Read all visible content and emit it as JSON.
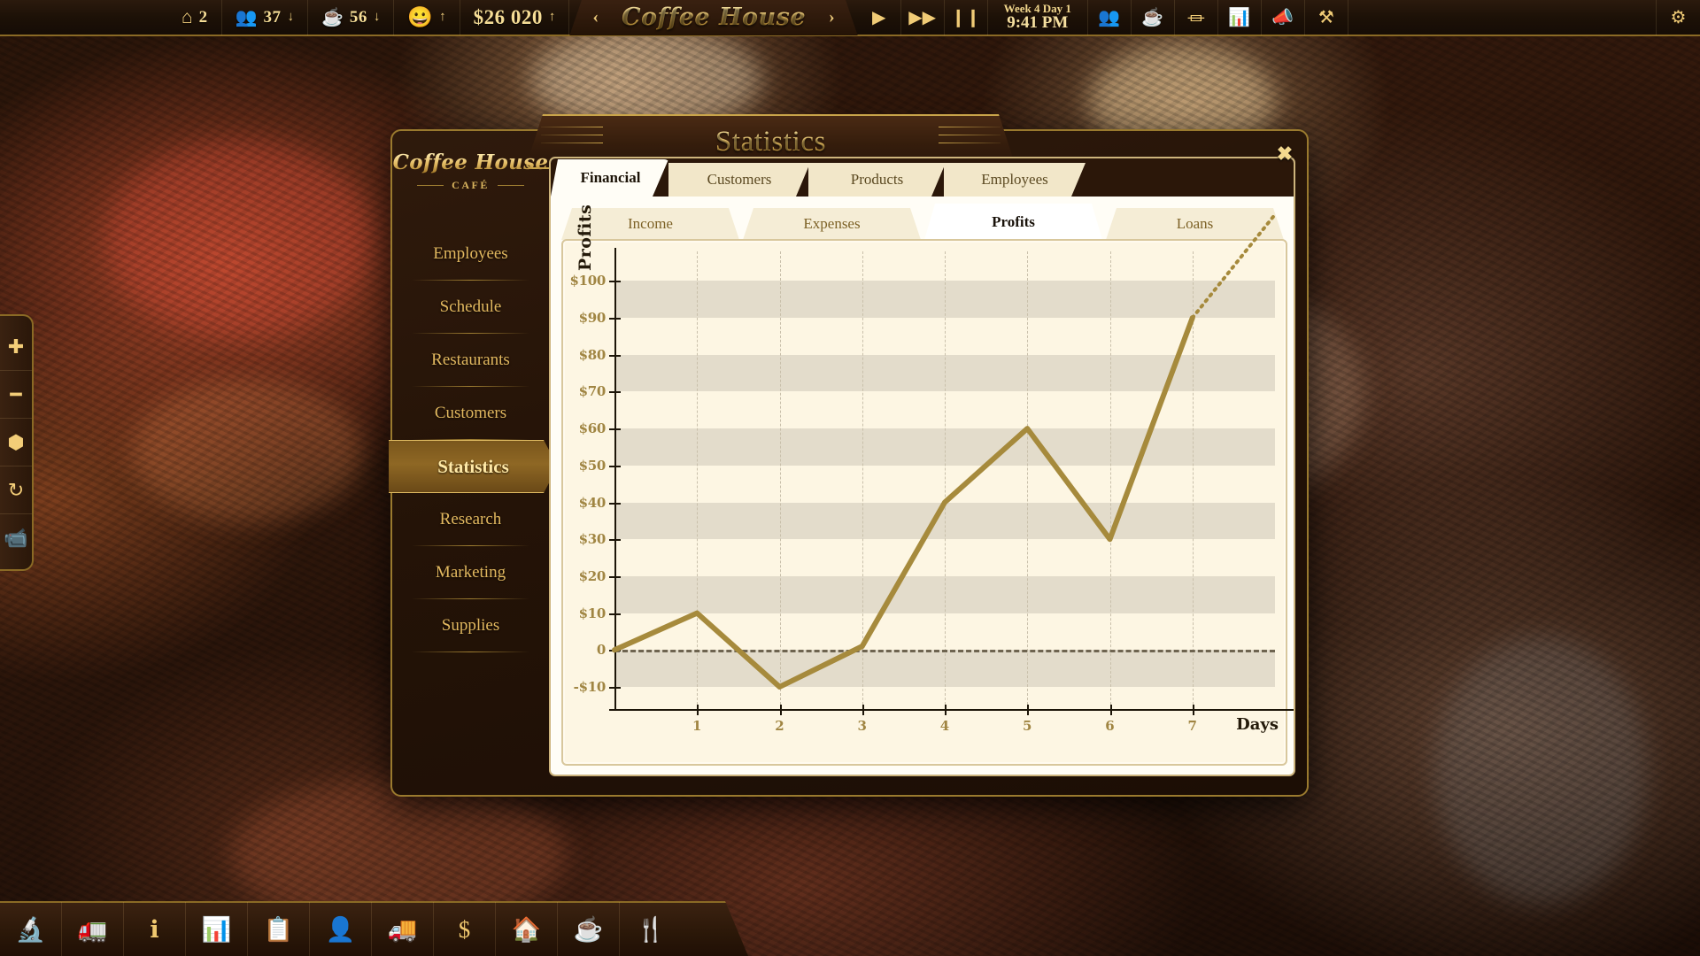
{
  "topbar": {
    "stats": [
      {
        "icon": "house-coffee-icon",
        "name": "restaurants-count",
        "value": "2",
        "trend": ""
      },
      {
        "icon": "customers-icon",
        "name": "customers-count",
        "value": "37",
        "trend": "↓"
      },
      {
        "icon": "coffee-cup-icon",
        "name": "coffee-served-count",
        "value": "56",
        "trend": "↓"
      },
      {
        "icon": "smiley-icon",
        "name": "satisfaction-indicator",
        "value": "",
        "trend": "↑"
      }
    ],
    "money": {
      "value": "$26 020",
      "trend": "↑"
    },
    "city": {
      "prev": "‹",
      "name": "Coffee House",
      "next": "›"
    },
    "speed": [
      {
        "icon": "play-icon",
        "name": "play-button"
      },
      {
        "icon": "fast-forward-icon",
        "name": "fast-forward-button"
      },
      {
        "icon": "pause-icon",
        "name": "pause-button"
      }
    ],
    "clock": {
      "week": "Week 4 Day 1",
      "time": "9:41 PM"
    },
    "tools": [
      {
        "icon": "employees-icon",
        "name": "employees-button"
      },
      {
        "icon": "coffee-icon",
        "name": "products-button"
      },
      {
        "icon": "furniture-icon",
        "name": "furniture-button"
      },
      {
        "icon": "statistics-icon",
        "name": "statistics-button"
      },
      {
        "icon": "marketing-icon",
        "name": "marketing-button"
      },
      {
        "icon": "build-icon",
        "name": "build-button"
      }
    ],
    "settings": {
      "icon": "gear-icon",
      "name": "settings-button"
    }
  },
  "left_toolbar": [
    {
      "icon": "zoom-in-icon",
      "name": "zoom-in-button",
      "glyph": "✚"
    },
    {
      "icon": "zoom-out-icon",
      "name": "zoom-out-button",
      "glyph": "━"
    },
    {
      "icon": "cube-icon",
      "name": "view-mode-button",
      "glyph": "⬢"
    },
    {
      "icon": "rotate-icon",
      "name": "rotate-view-button",
      "glyph": "⟳"
    },
    {
      "icon": "camera-eye-icon",
      "name": "camera-view-button",
      "glyph": "▰"
    }
  ],
  "bottom_toolbar": [
    {
      "icon": "microscope-gear-icon",
      "name": "research-button"
    },
    {
      "icon": "bulldozer-icon",
      "name": "construction-button"
    },
    {
      "icon": "info-icon",
      "name": "info-button"
    },
    {
      "icon": "bar-chart-icon",
      "name": "statistics-button"
    },
    {
      "icon": "clipboard-check-icon",
      "name": "tasks-button"
    },
    {
      "icon": "employee-money-icon",
      "name": "employees-button"
    },
    {
      "icon": "delivery-cart-icon",
      "name": "supplies-button"
    },
    {
      "icon": "dollar-icon",
      "name": "finance-button"
    },
    {
      "icon": "house-money-icon",
      "name": "real-estate-button"
    },
    {
      "icon": "coffee-gear-icon",
      "name": "products-button"
    },
    {
      "icon": "cutlery-gear-icon",
      "name": "menu-button"
    }
  ],
  "window": {
    "title": "Statistics",
    "close_label": "✖",
    "brand": {
      "line1": "Coffee House",
      "line2": "CAFÉ"
    },
    "nav": [
      {
        "label": "Employees",
        "active": false
      },
      {
        "label": "Schedule",
        "active": false
      },
      {
        "label": "Restaurants",
        "active": false
      },
      {
        "label": "Customers",
        "active": false
      },
      {
        "label": "Statistics",
        "active": true
      },
      {
        "label": "Research",
        "active": false
      },
      {
        "label": "Marketing",
        "active": false
      },
      {
        "label": "Supplies",
        "active": false
      }
    ],
    "tabs_primary": [
      {
        "label": "Financial",
        "active": true
      },
      {
        "label": "Customers",
        "active": false
      },
      {
        "label": "Products",
        "active": false
      },
      {
        "label": "Employees",
        "active": false
      }
    ],
    "tabs_secondary": [
      {
        "label": "Income",
        "active": false
      },
      {
        "label": "Expenses",
        "active": false
      },
      {
        "label": "Profits",
        "active": true
      },
      {
        "label": "Loans",
        "active": false
      }
    ]
  },
  "chart_data": {
    "type": "line",
    "title": "Profits",
    "xlabel": "Days",
    "ylabel": "Profits",
    "x": [
      0,
      1,
      2,
      3,
      4,
      5,
      6,
      7
    ],
    "values": [
      0,
      10,
      -10,
      1,
      40,
      60,
      30,
      90
    ],
    "categories": [
      "",
      "1",
      "2",
      "3",
      "4",
      "5",
      "6",
      "7"
    ],
    "xtick_labels": [
      "1",
      "2",
      "3",
      "4",
      "5",
      "6",
      "7"
    ],
    "ytick_labels": [
      "$100",
      "$90",
      "$80",
      "$70",
      "$60",
      "$50",
      "$40",
      "$30",
      "$20",
      "$10",
      "0",
      "-$10"
    ],
    "ytick_values": [
      100,
      90,
      80,
      70,
      60,
      50,
      40,
      30,
      20,
      10,
      0,
      -10
    ],
    "ylim": [
      -16,
      108
    ],
    "xlim": [
      0,
      8
    ],
    "grid": true,
    "zero_line": true,
    "legend": "none",
    "series_color": "#a68a3c",
    "projection": {
      "style": "dotted",
      "from": [
        7,
        90
      ],
      "to": [
        8,
        118
      ]
    }
  }
}
